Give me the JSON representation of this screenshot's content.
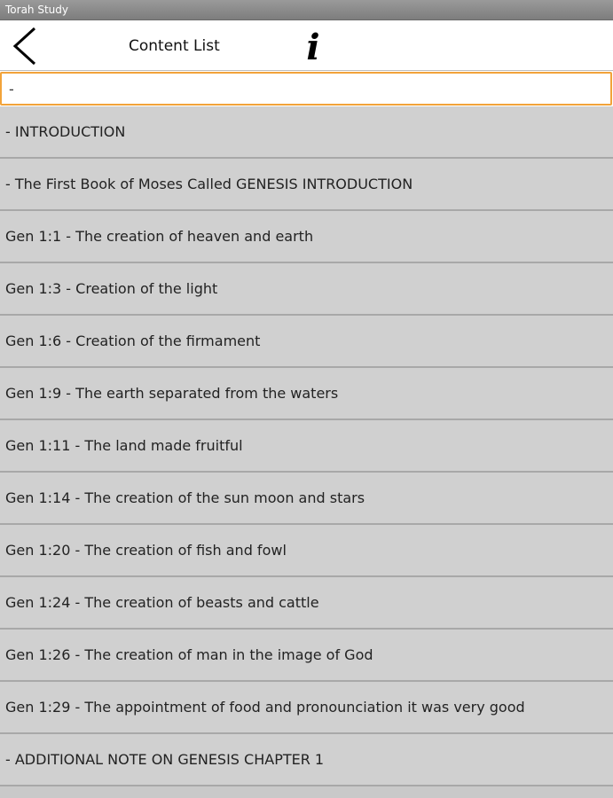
{
  "window": {
    "title": "Torah Study"
  },
  "header": {
    "title": "Content List",
    "back_icon": "chevron-left-icon",
    "info_icon": "info-icon",
    "info_glyph": "i"
  },
  "search": {
    "value": "-"
  },
  "colors": {
    "accent": "#f2a33a",
    "list_background": "#d0d0d0",
    "divider": "#a8a8a8"
  },
  "items": [
    {
      "label": "- INTRODUCTION"
    },
    {
      "label": "- The First Book of Moses Called GENESIS INTRODUCTION"
    },
    {
      "label": "Gen 1:1 - The creation of heaven and earth"
    },
    {
      "label": "Gen 1:3 - Creation of the light"
    },
    {
      "label": "Gen 1:6 - Creation of the firmament"
    },
    {
      "label": "Gen 1:9 - The earth separated from the waters"
    },
    {
      "label": "Gen 1:11 - The land made fruitful"
    },
    {
      "label": "Gen 1:14 - The creation of the sun moon and stars"
    },
    {
      "label": "Gen 1:20 - The creation of fish and fowl"
    },
    {
      "label": "Gen 1:24 - The creation of beasts and cattle"
    },
    {
      "label": "Gen 1:26 - The creation of man in the image of God"
    },
    {
      "label": "Gen 1:29 - The appointment of food and pronounciation it was very good"
    },
    {
      "label": "- ADDITIONAL NOTE ON GENESIS CHAPTER 1"
    }
  ]
}
